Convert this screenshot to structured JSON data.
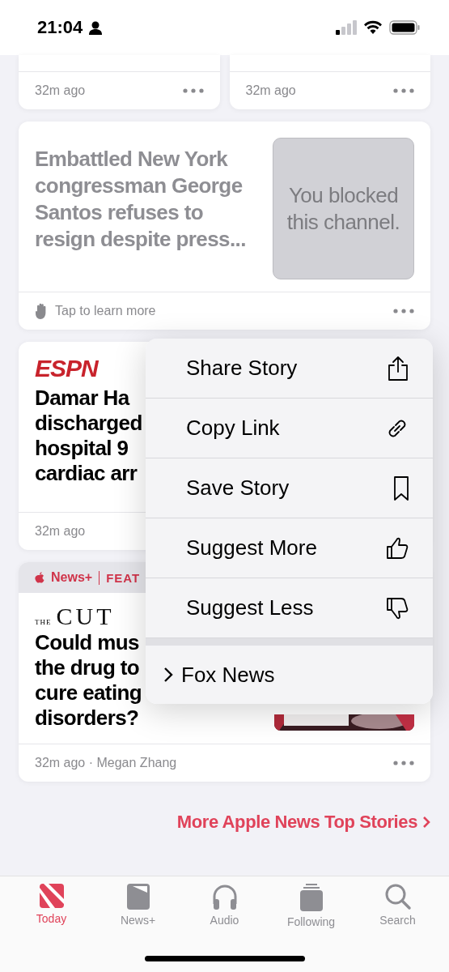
{
  "status_bar": {
    "time": "21:04"
  },
  "top_cards": [
    {
      "time": "32m ago"
    },
    {
      "time": "32m ago"
    }
  ],
  "blocked_story": {
    "headline": "Embattled New York congressman George Santos refuses to resign despite press...",
    "image_note": "You blocked this channel.",
    "footer": "Tap to learn more"
  },
  "stories": [
    {
      "kind": "espn",
      "source": "ESPN",
      "headline_lines": [
        "Damar Ha",
        "discharged",
        "hospital 9",
        "cardiac arr"
      ],
      "time": "32m ago"
    },
    {
      "kind": "cut",
      "banner": {
        "brand": "News+",
        "label": "FEAT"
      },
      "source_prefix": "THE",
      "source": "CUT",
      "headline_lines": [
        "Could mus",
        "the drug to",
        "cure eating",
        "disorders?"
      ],
      "time": "32m ago · Megan Zhang",
      "more_button": true
    }
  ],
  "more_link": "More Apple News Top Stories",
  "menu": {
    "items": [
      {
        "label": "Share Story",
        "kind": "share"
      },
      {
        "label": "Copy Link",
        "kind": "link"
      },
      {
        "label": "Save Story",
        "kind": "save"
      },
      {
        "label": "Suggest More",
        "kind": "more"
      },
      {
        "label": "Suggest Less",
        "kind": "less"
      }
    ],
    "channel": "Fox News"
  },
  "tab_bar": [
    {
      "label": "Today",
      "kind": "today",
      "selected": true
    },
    {
      "label": "News+",
      "kind": "newsplus",
      "selected": false
    },
    {
      "label": "Audio",
      "kind": "audio",
      "selected": false
    },
    {
      "label": "Following",
      "kind": "following",
      "selected": false
    },
    {
      "label": "Search",
      "kind": "search",
      "selected": false
    }
  ]
}
